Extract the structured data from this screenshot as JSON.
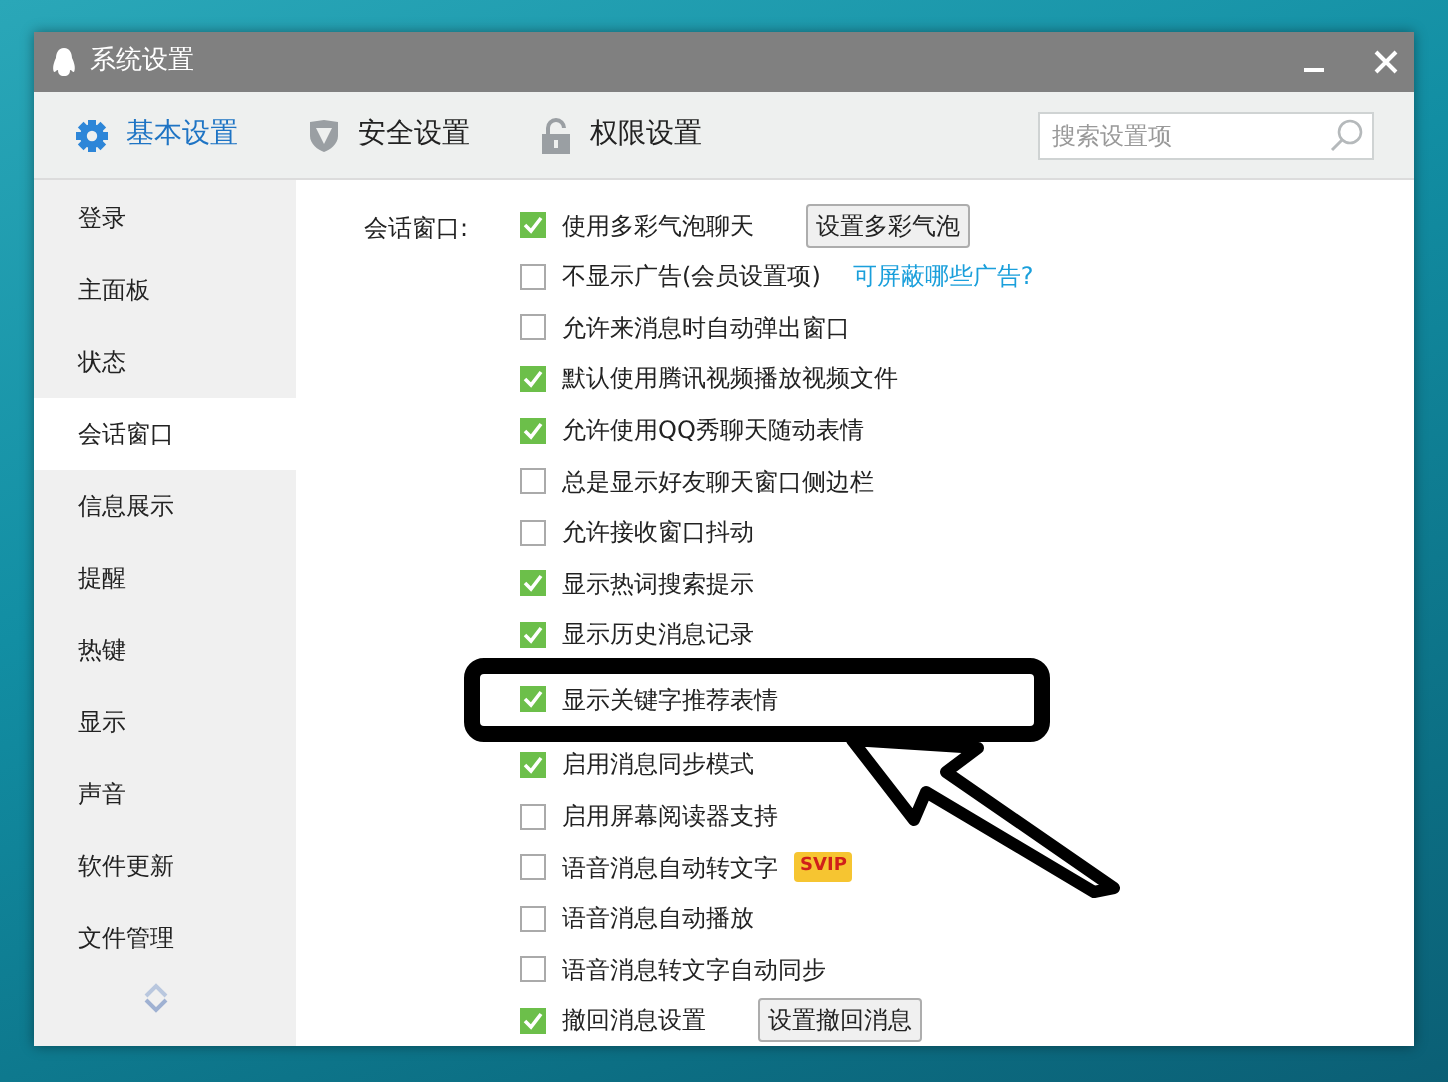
{
  "window": {
    "title": "系统设置"
  },
  "tabs": [
    {
      "label": "基本设置",
      "selected": true,
      "kind": "gear"
    },
    {
      "label": "安全设置",
      "selected": false,
      "kind": "shield"
    },
    {
      "label": "权限设置",
      "selected": false,
      "kind": "lock"
    }
  ],
  "search": {
    "placeholder": "搜索设置项"
  },
  "sidebar": {
    "items": [
      {
        "label": "登录",
        "selected": false
      },
      {
        "label": "主面板",
        "selected": false
      },
      {
        "label": "状态",
        "selected": false
      },
      {
        "label": "会话窗口",
        "selected": true
      },
      {
        "label": "信息展示",
        "selected": false
      },
      {
        "label": "提醒",
        "selected": false
      },
      {
        "label": "热键",
        "selected": false
      },
      {
        "label": "显示",
        "selected": false
      },
      {
        "label": "声音",
        "selected": false
      },
      {
        "label": "软件更新",
        "selected": false
      },
      {
        "label": "文件管理",
        "selected": false
      }
    ]
  },
  "section": {
    "label": "会话窗口:",
    "options": [
      {
        "label": "使用多彩气泡聊天",
        "checked": true,
        "highlighted": false,
        "button": "设置多彩气泡"
      },
      {
        "label": "不显示广告(会员设置项)",
        "checked": false,
        "highlighted": false,
        "link": "可屏蔽哪些广告?"
      },
      {
        "label": "允许来消息时自动弹出窗口",
        "checked": false,
        "highlighted": false
      },
      {
        "label": "默认使用腾讯视频播放视频文件",
        "checked": true,
        "highlighted": false
      },
      {
        "label": "允许使用QQ秀聊天随动表情",
        "checked": true,
        "highlighted": false
      },
      {
        "label": "总是显示好友聊天窗口侧边栏",
        "checked": false,
        "highlighted": false
      },
      {
        "label": "允许接收窗口抖动",
        "checked": false,
        "highlighted": false
      },
      {
        "label": "显示热词搜索提示",
        "checked": true,
        "highlighted": false
      },
      {
        "label": "显示历史消息记录",
        "checked": true,
        "highlighted": false
      },
      {
        "label": "显示关键字推荐表情",
        "checked": true,
        "highlighted": true
      },
      {
        "label": "启用消息同步模式",
        "checked": true,
        "highlighted": false
      },
      {
        "label": "启用屏幕阅读器支持",
        "checked": false,
        "highlighted": false
      },
      {
        "label": "语音消息自动转文字",
        "checked": false,
        "highlighted": false,
        "badge": "SVIP"
      },
      {
        "label": "语音消息自动播放",
        "checked": false,
        "highlighted": false
      },
      {
        "label": "语音消息转文字自动同步",
        "checked": false,
        "highlighted": false
      },
      {
        "label": "撤回消息设置",
        "checked": true,
        "highlighted": false,
        "button": "设置撤回消息"
      }
    ]
  }
}
